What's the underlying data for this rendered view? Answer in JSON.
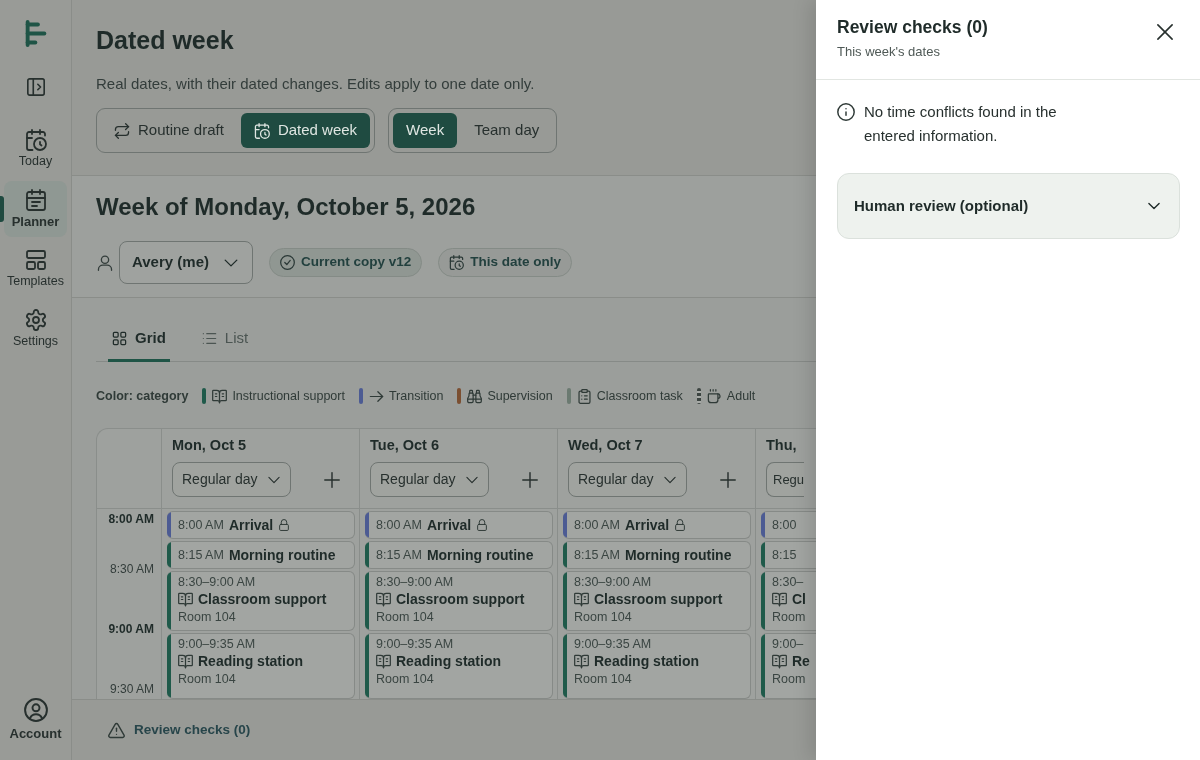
{
  "sidebar": {
    "items": [
      {
        "label": "Today",
        "kind": "today",
        "selected": false
      },
      {
        "label": "Planner",
        "kind": "planner",
        "selected": true
      },
      {
        "label": "Templates",
        "kind": "templates",
        "selected": false
      },
      {
        "label": "Settings",
        "kind": "settings",
        "selected": false
      }
    ],
    "account": "Account"
  },
  "header": {
    "title": "Dated week",
    "subtitle": "Real dates, with their dated changes. Edits apply to one date only.",
    "modes": [
      {
        "label": "Routine draft",
        "kind": "routine",
        "selected": false
      },
      {
        "label": "Dated week",
        "kind": "dated",
        "selected": true
      }
    ],
    "views": [
      {
        "label": "Week",
        "selected": true
      },
      {
        "label": "Team day",
        "selected": false
      }
    ]
  },
  "week": {
    "title": "Week of Monday, October 5, 2026",
    "person": "Avery (me)",
    "chips": [
      {
        "label": "Current copy v12",
        "kind": "version"
      },
      {
        "label": "This date only",
        "kind": "scope"
      }
    ]
  },
  "tabs": [
    {
      "label": "Grid",
      "kind": "grid",
      "selected": true
    },
    {
      "label": "List",
      "kind": "list",
      "selected": false
    }
  ],
  "legend": {
    "title": "Color: category",
    "items": [
      {
        "label": "Instructional support",
        "kind": "book",
        "color": "#1f5a4a",
        "striped": false
      },
      {
        "label": "Transition",
        "kind": "arrow",
        "color": "#4c5b93",
        "striped": false
      },
      {
        "label": "Supervision",
        "kind": "binoculars",
        "color": "#7b4f31",
        "striped": false
      },
      {
        "label": "Classroom task",
        "kind": "clipboard",
        "color": "#6b7a71",
        "striped": false
      },
      {
        "label": "Adult",
        "kind": "cup",
        "color": "#3c4441",
        "striped": true
      }
    ]
  },
  "grid": {
    "times": [
      {
        "label": "8:00 AM",
        "major": true
      },
      {
        "label": "8:30 AM",
        "major": false
      },
      {
        "label": "9:00 AM",
        "major": true
      },
      {
        "label": "9:30 AM",
        "major": false
      }
    ],
    "days": [
      {
        "name": "Mon, Oct 5",
        "day_type": "Regular day",
        "partial": false,
        "events": [
          {
            "kind": "line",
            "time": "8:00 AM",
            "title": "Arrival",
            "color": "#4c5b93",
            "locked": true
          },
          {
            "kind": "line",
            "time": "8:15 AM",
            "title": "Morning routine",
            "color": "#1f5a4a",
            "locked": false
          },
          {
            "kind": "block",
            "time": "8:30–9:00 AM",
            "title": "Classroom support",
            "room": "Room 104",
            "color": "#1f5a4a",
            "locked": false
          },
          {
            "kind": "block",
            "time": "9:00–9:35 AM",
            "title": "Reading station",
            "room": "Room 104",
            "color": "#1f5a4a",
            "locked": false
          }
        ]
      },
      {
        "name": "Tue, Oct 6",
        "day_type": "Regular day",
        "partial": false,
        "events": [
          {
            "kind": "line",
            "time": "8:00 AM",
            "title": "Arrival",
            "color": "#4c5b93",
            "locked": true
          },
          {
            "kind": "line",
            "time": "8:15 AM",
            "title": "Morning routine",
            "color": "#1f5a4a",
            "locked": false
          },
          {
            "kind": "block",
            "time": "8:30–9:00 AM",
            "title": "Classroom support",
            "room": "Room 104",
            "color": "#1f5a4a",
            "locked": false
          },
          {
            "kind": "block",
            "time": "9:00–9:35 AM",
            "title": "Reading station",
            "room": "Room 104",
            "color": "#1f5a4a",
            "locked": false
          }
        ]
      },
      {
        "name": "Wed, Oct 7",
        "day_type": "Regular day",
        "partial": false,
        "events": [
          {
            "kind": "line",
            "time": "8:00 AM",
            "title": "Arrival",
            "color": "#4c5b93",
            "locked": true
          },
          {
            "kind": "line",
            "time": "8:15 AM",
            "title": "Morning routine",
            "color": "#1f5a4a",
            "locked": false
          },
          {
            "kind": "block",
            "time": "8:30–9:00 AM",
            "title": "Classroom support",
            "room": "Room 104",
            "color": "#1f5a4a",
            "locked": false
          },
          {
            "kind": "block",
            "time": "9:00–9:35 AM",
            "title": "Reading station",
            "room": "Room 104",
            "color": "#1f5a4a",
            "locked": false
          }
        ]
      },
      {
        "name": "Thu,",
        "day_type": "Regu",
        "partial": true,
        "events": [
          {
            "kind": "line",
            "time": "8:00",
            "color": "#4c5b93",
            "locked": false
          },
          {
            "kind": "line",
            "time": "8:15",
            "color": "#1f5a4a",
            "locked": false
          },
          {
            "kind": "block",
            "time": "8:30–",
            "title": "Cl",
            "room": "Room",
            "color": "#1f5a4a",
            "locked": false
          },
          {
            "kind": "block",
            "time": "9:00–",
            "title": "Re",
            "room": "Room",
            "color": "#1f5a4a",
            "locked": false
          }
        ]
      }
    ]
  },
  "footer": {
    "review": "Review checks (0)"
  },
  "drawer": {
    "title": "Review checks (0)",
    "subtitle": "This week's dates",
    "message": "No time conflicts found in the entered information.",
    "accordion": {
      "label": "Human review (optional)",
      "expanded": false
    }
  }
}
